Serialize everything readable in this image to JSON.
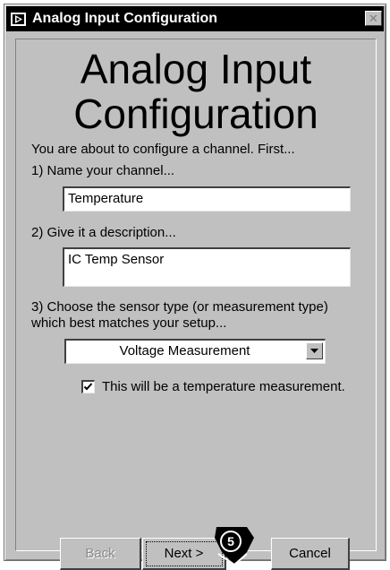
{
  "window": {
    "title": "Analog Input Configuration",
    "close_glyph": "✕"
  },
  "heading": "Analog Input\nConfiguration",
  "intro": "You are about to configure a channel. First...",
  "step1": {
    "label": "1) Name your channel...",
    "value": "Temperature"
  },
  "step2": {
    "label": "2) Give it a description...",
    "value": "IC Temp Sensor"
  },
  "step3": {
    "label_line1": "3) Choose the sensor type (or measurement type)",
    "label_line2": "which best matches your setup...",
    "selected": "Voltage Measurement"
  },
  "temperature_checkbox": {
    "label": "This will be a temperature measurement.",
    "checked": true
  },
  "buttons": {
    "back": "Back",
    "next": "Next >",
    "cancel": "Cancel"
  },
  "callout": {
    "number": "5"
  }
}
